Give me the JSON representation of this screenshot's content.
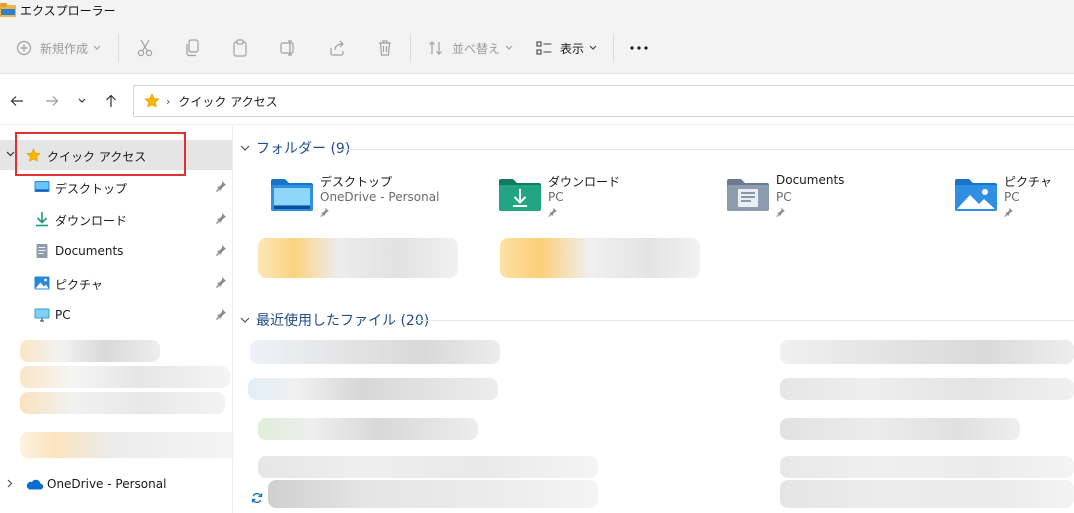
{
  "window": {
    "title": "エクスプローラー"
  },
  "toolbar": {
    "new_label": "新規作成",
    "sort_label": "並べ替え",
    "view_label": "表示"
  },
  "address": {
    "path": "クイック アクセス"
  },
  "sidebar": {
    "quick_access": "クイック アクセス",
    "items": [
      {
        "label": "デスクトップ",
        "icon": "desktop-icon"
      },
      {
        "label": "ダウンロード",
        "icon": "download-icon"
      },
      {
        "label": "Documents",
        "icon": "documents-icon"
      },
      {
        "label": "ピクチャ",
        "icon": "pictures-icon"
      },
      {
        "label": "PC",
        "icon": "pc-icon"
      }
    ],
    "onedrive": "OneDrive - Personal"
  },
  "main": {
    "folders_header": "フォルダー (9)",
    "recent_header": "最近使用したファイル (20)",
    "folders": [
      {
        "name": "デスクトップ",
        "location": "OneDrive - Personal"
      },
      {
        "name": "ダウンロード",
        "location": "PC"
      },
      {
        "name": "Documents",
        "location": "PC"
      },
      {
        "name": "ピクチャ",
        "location": "PC"
      }
    ]
  },
  "colors": {
    "selection_box": "#e03131",
    "header_text": "#1f4e8c",
    "sidebar_selected": "#e5e5e5"
  }
}
